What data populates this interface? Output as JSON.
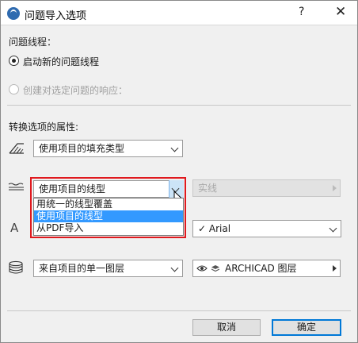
{
  "window": {
    "title": "问题导入选项",
    "help_glyph": "?",
    "close_glyph": "✕"
  },
  "issue_thread": {
    "heading": "问题线程：",
    "option_new": "启动新的问题线程",
    "option_new_checked": true,
    "option_reply": "创建对选定问题的响应：",
    "option_reply_enabled": false
  },
  "convert": {
    "heading": "转换选项的属性:",
    "fill": {
      "icon": "fill-type-icon",
      "value": "使用项目的填充类型"
    },
    "line": {
      "icon": "line-type-icon",
      "value": "使用项目的线型",
      "options": [
        "用统一的线型覆盖",
        "使用项目的线型",
        "从PDF导入"
      ],
      "selected_index": 1,
      "override_value": "实线",
      "override_enabled": false
    },
    "font": {
      "icon": "text-font-icon",
      "icon_glyph": "A",
      "value": "Arial",
      "check_glyph": "✓"
    },
    "layer": {
      "icon": "layers-icon",
      "value": "来自项目的单一图层",
      "target_value": "ARCHICAD 图层"
    }
  },
  "footer": {
    "cancel_label": "取消",
    "ok_label": "确定"
  },
  "colors": {
    "highlight": "#3399ff",
    "focus_frame": "#e0191e",
    "default_button_border": "#0078d7"
  }
}
